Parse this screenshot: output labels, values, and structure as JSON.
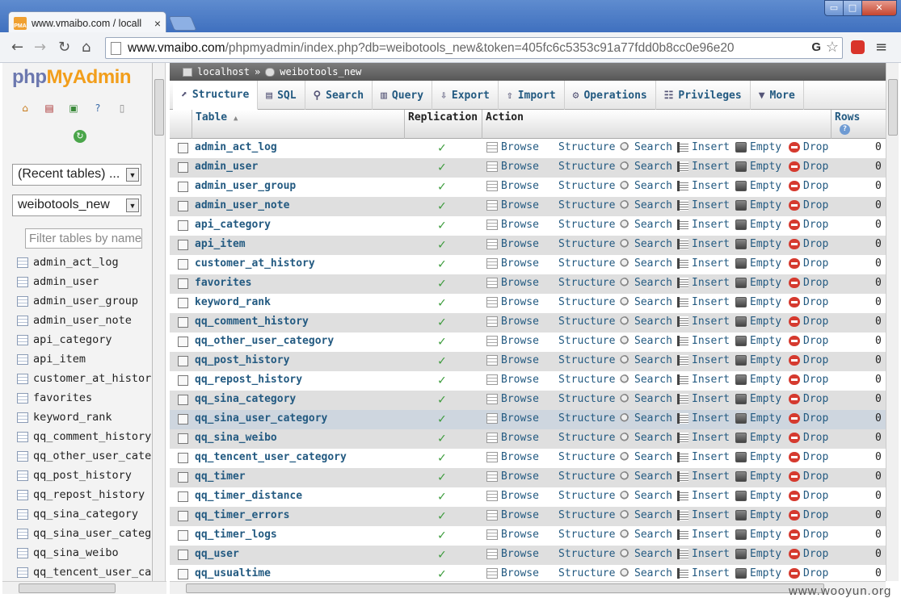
{
  "browser": {
    "tab_title": "www.vmaibo.com / locall",
    "tab_favicon": "PMA",
    "tab_close": "×",
    "window_controls": {
      "min": "▭",
      "max": "□",
      "close": "✕"
    },
    "url_host": "www.vmaibo.com",
    "url_path": "/phpmyadmin/index.php?db=weibotools_new&token=405fc6c5353c91a77fdd0b8cc0e96e20"
  },
  "logo": {
    "part1": "php",
    "part2": "MyAdmin"
  },
  "sidebar": {
    "recent_tables": "(Recent tables) ...",
    "database": "weibotools_new",
    "filter_placeholder": "Filter tables by name",
    "tables": [
      "admin_act_log",
      "admin_user",
      "admin_user_group",
      "admin_user_note",
      "api_category",
      "api_item",
      "customer_at_history",
      "favorites",
      "keyword_rank",
      "qq_comment_history",
      "qq_other_user_categ",
      "qq_post_history",
      "qq_repost_history",
      "qq_sina_category",
      "qq_sina_user_catego",
      "qq_sina_weibo",
      "qq_tencent_user_cat"
    ]
  },
  "breadcrumb": {
    "server": "localhost",
    "separator": "»",
    "database": "weibotools_new"
  },
  "tabs": [
    {
      "label": "Structure",
      "icon": "structure-icon"
    },
    {
      "label": "SQL",
      "icon": "sql-icon"
    },
    {
      "label": "Search",
      "icon": "search-icon"
    },
    {
      "label": "Query",
      "icon": "query-icon"
    },
    {
      "label": "Export",
      "icon": "export-icon"
    },
    {
      "label": "Import",
      "icon": "import-icon"
    },
    {
      "label": "Operations",
      "icon": "operations-icon"
    },
    {
      "label": "Privileges",
      "icon": "privileges-icon"
    },
    {
      "label": "More",
      "icon": "chevron-down-icon"
    }
  ],
  "table_header": {
    "table": "Table",
    "replication": "Replication",
    "action": "Action",
    "rows": "Rows"
  },
  "actions": {
    "browse": "Browse",
    "structure": "Structure",
    "search": "Search",
    "insert": "Insert",
    "empty": "Empty",
    "drop": "Drop"
  },
  "rows": [
    {
      "name": "admin_act_log",
      "rows": "0"
    },
    {
      "name": "admin_user",
      "rows": "0"
    },
    {
      "name": "admin_user_group",
      "rows": "0"
    },
    {
      "name": "admin_user_note",
      "rows": "0"
    },
    {
      "name": "api_category",
      "rows": "0"
    },
    {
      "name": "api_item",
      "rows": "0"
    },
    {
      "name": "customer_at_history",
      "rows": "0"
    },
    {
      "name": "favorites",
      "rows": "0"
    },
    {
      "name": "keyword_rank",
      "rows": "0"
    },
    {
      "name": "qq_comment_history",
      "rows": "0"
    },
    {
      "name": "qq_other_user_category",
      "rows": "0"
    },
    {
      "name": "qq_post_history",
      "rows": "0"
    },
    {
      "name": "qq_repost_history",
      "rows": "0"
    },
    {
      "name": "qq_sina_category",
      "rows": "0"
    },
    {
      "name": "qq_sina_user_category",
      "rows": "0",
      "highlighted": true
    },
    {
      "name": "qq_sina_weibo",
      "rows": "0"
    },
    {
      "name": "qq_tencent_user_category",
      "rows": "0"
    },
    {
      "name": "qq_timer",
      "rows": "0"
    },
    {
      "name": "qq_timer_distance",
      "rows": "0"
    },
    {
      "name": "qq_timer_errors",
      "rows": "0"
    },
    {
      "name": "qq_timer_logs",
      "rows": "0"
    },
    {
      "name": "qq_user",
      "rows": "0"
    },
    {
      "name": "qq_usualtime",
      "rows": "0"
    }
  ],
  "watermark": "www.wooyun.org",
  "colors": {
    "link": "#235a81",
    "highlight_row": "#ced6df",
    "check": "#3a9a3a",
    "drop": "#d53a2f"
  }
}
